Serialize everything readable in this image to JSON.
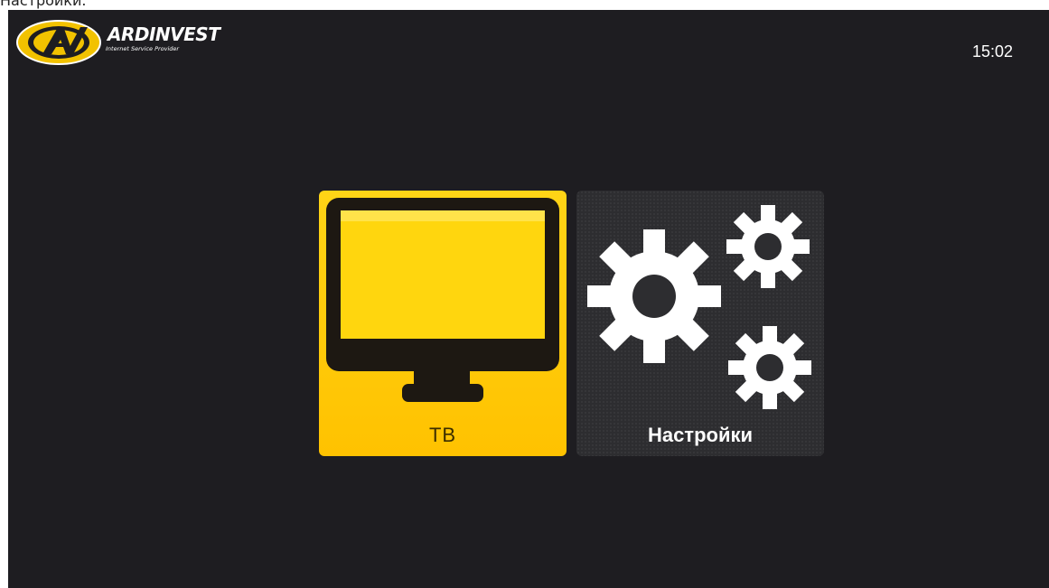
{
  "caption": "Настройки.",
  "header": {
    "logo_text": "ARDINVEST",
    "logo_subtext": "Internet Service Provider",
    "clock": "15:02"
  },
  "menu": {
    "tiles": [
      {
        "id": "tv",
        "label": "ТВ",
        "icon": "tv-monitor-icon",
        "selected": true
      },
      {
        "id": "settings",
        "label": "Настройки",
        "icon": "gears-icon",
        "selected": false
      }
    ]
  },
  "colors": {
    "background": "#1e1d21",
    "accent_yellow": "#ffc800",
    "tile_dark": "#2d2d30"
  }
}
